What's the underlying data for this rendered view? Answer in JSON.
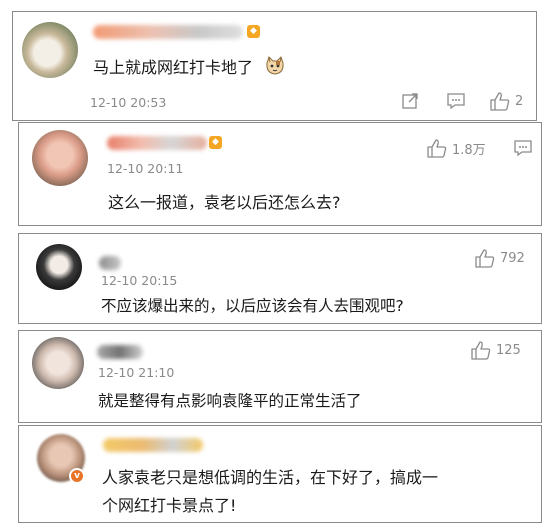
{
  "comments": [
    {
      "username": "",
      "text": "马上就成网红打卡地了",
      "emoji_icon": "cat-face-emoji",
      "time": "12-10 20:53",
      "share_icon": "share-icon",
      "reply_icon": "comment-icon",
      "like_icon": "thumbs-up-icon",
      "likes": "2"
    },
    {
      "username": "",
      "time": "12-10 20:11",
      "text": "这么一报道，袁老以后还怎么去?",
      "like_icon": "thumbs-up-icon",
      "likes": "1.8万",
      "reply_icon": "comment-icon"
    },
    {
      "username": "",
      "time": "12-10 20:15",
      "text": "不应该爆出来的，以后应该会有人去围观吧?",
      "like_icon": "thumbs-up-icon",
      "likes": "792"
    },
    {
      "username": "",
      "time": "12-10 21:10",
      "text": "就是整得有点影响袁隆平的正常生活了",
      "like_icon": "thumbs-up-icon",
      "likes": "125"
    },
    {
      "username": "",
      "text_line1": "人家袁老只是想低调的生活，在下好了，搞成一",
      "text_line2": "个网红打卡景点了!",
      "verified_badge": "verified-v-badge"
    }
  ],
  "colors": {
    "border": "#8a8a8a",
    "meta_text": "#8a8a8a",
    "body_text": "#1a1a1a",
    "vip_badge": "#f5a623",
    "verified": "#e8742a"
  }
}
